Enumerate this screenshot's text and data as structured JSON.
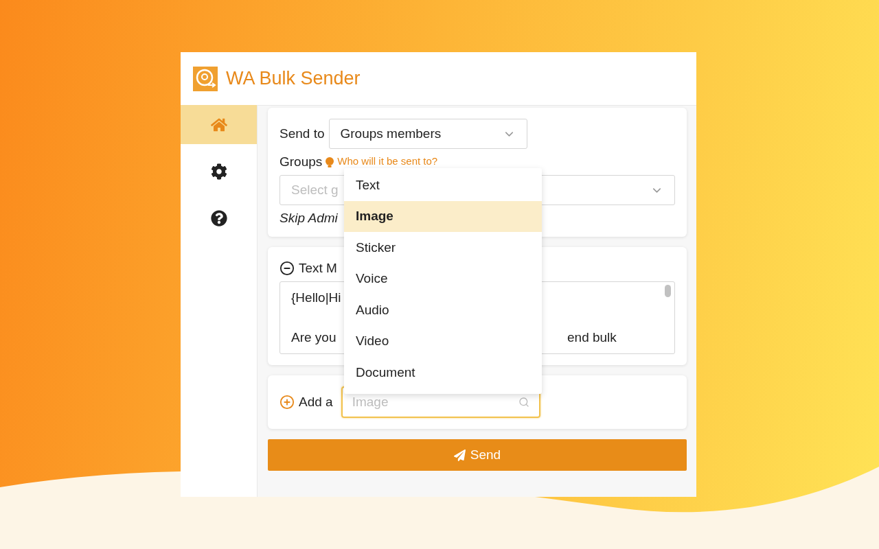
{
  "app": {
    "title": "WA Bulk Sender"
  },
  "sidebar": {
    "items": [
      {
        "kind": "home",
        "selected": true
      },
      {
        "kind": "settings",
        "selected": false
      },
      {
        "kind": "help",
        "selected": false
      }
    ]
  },
  "recipients": {
    "send_to_label": "Send to",
    "send_to_value": "Groups members",
    "groups_label": "Groups",
    "hint_link": "Who will it be sent to?",
    "groups_placeholder": "Select g",
    "skip_label": "Skip Admi"
  },
  "message": {
    "title": "Text M",
    "lines": [
      [
        "{Hello|Hi"
      ],
      [
        "Are you",
        "end bulk"
      ]
    ]
  },
  "attachment": {
    "label": "Add a",
    "placeholder": "Image"
  },
  "dropdown": {
    "options": [
      {
        "label": "Text",
        "selected": false
      },
      {
        "label": "Image",
        "selected": true
      },
      {
        "label": "Sticker",
        "selected": false
      },
      {
        "label": "Voice",
        "selected": false
      },
      {
        "label": "Audio",
        "selected": false
      },
      {
        "label": "Video",
        "selected": false
      },
      {
        "label": "Document",
        "selected": false
      }
    ]
  },
  "send_button": "Send"
}
